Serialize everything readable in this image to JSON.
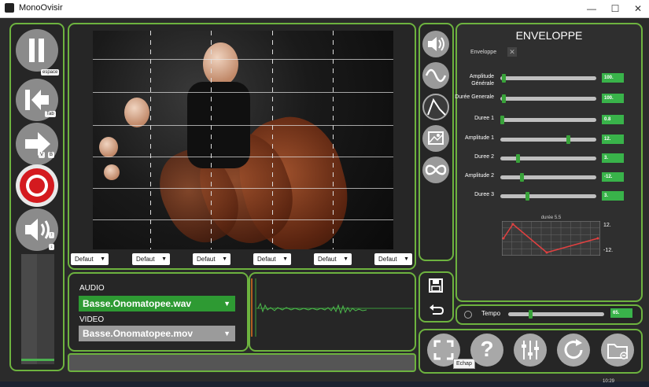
{
  "window": {
    "title": "MonoOvisir",
    "minimize": "—",
    "maximize": "☐",
    "close": "✕"
  },
  "transport": {
    "pause_key": "espace",
    "back_key": "Tab",
    "forward_keys": [
      "V",
      "B"
    ],
    "vol_up": "↑",
    "vol_down": "↓"
  },
  "presets": [
    "Defaut",
    "Defaut",
    "Defaut",
    "Defaut",
    "Defaut",
    "Defaut"
  ],
  "media": {
    "audio_label": "AUDIO",
    "audio_file": "Basse.Onomatopee.wav",
    "video_label": "VIDEO",
    "video_file": "Basse.Onomatopee.mov"
  },
  "envelope": {
    "title": "ENVELOPPE",
    "toggle_label": "Enveloppe",
    "rows": [
      {
        "label": "Amplitude Générale",
        "value": "100.",
        "level": 0.02
      },
      {
        "label": "Durée Generale",
        "value": "100.",
        "level": 0.02
      },
      {
        "label": "Duree 1",
        "value": "0.8",
        "level": 0.0
      },
      {
        "label": "Amplitude 1",
        "value": "12.",
        "level": 0.72
      },
      {
        "label": "Duree 2",
        "value": "3.",
        "level": 0.17
      },
      {
        "label": "Amplitude 2",
        "value": "-12.",
        "level": 0.21
      },
      {
        "label": "Duree 3",
        "value": "3.",
        "level": 0.27
      }
    ],
    "graph": {
      "caption": "durée 5.5",
      "y_max": "12.",
      "y_min": "-12.",
      "points": [
        0,
        12,
        3,
        -12,
        0
      ]
    }
  },
  "tempo": {
    "label": "Tempo",
    "value": "65.",
    "level": 0.22
  },
  "tooltip": "Echap",
  "clock": "10:29"
}
